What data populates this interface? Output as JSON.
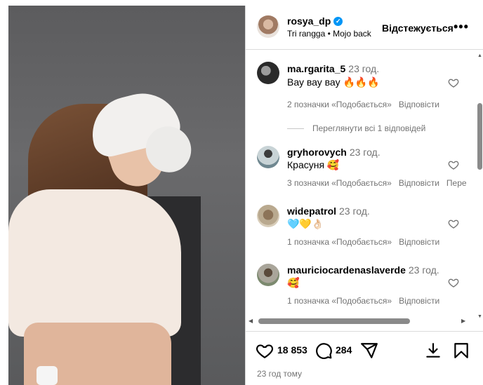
{
  "post": {
    "username": "rosya_dp",
    "audio": "Tri rangga • Mojo back",
    "follow_label": "Відстежується",
    "more_label": "•••",
    "likes": "18 853",
    "comments_count": "284",
    "time_ago": "23 год тому"
  },
  "comments": [
    {
      "user": "ma.rgarita_5",
      "time": "23 год.",
      "text": "Вау вау вау 🔥🔥🔥",
      "likes": "2 позначки «Подобається»",
      "reply": "Відповісти",
      "translate": "",
      "view_replies": "Переглянути всі 1 відповідей"
    },
    {
      "user": "gryhorovych",
      "time": "23 год.",
      "text": "Красуня 🥰",
      "likes": "3 позначки «Подобається»",
      "reply": "Відповісти",
      "translate": "Пере"
    },
    {
      "user": "widepatrol",
      "time": "23 год.",
      "text": "🩵💛👌🏻",
      "likes": "1 позначка «Подобається»",
      "reply": "Відповісти",
      "translate": ""
    },
    {
      "user": "mauriciocardenaslaverde",
      "time": "23 год.",
      "text": "🥰",
      "likes": "1 позначка «Подобається»",
      "reply": "Відповісти",
      "translate": ""
    }
  ],
  "colors": {
    "verified": "#0095f6",
    "secondary_text": "#737373",
    "divider": "#dbdbdb"
  },
  "icons": [
    "verified-badge-icon",
    "heart-icon",
    "comment-icon",
    "share-icon",
    "save-icon",
    "bookmark-icon",
    "more-icon"
  ]
}
